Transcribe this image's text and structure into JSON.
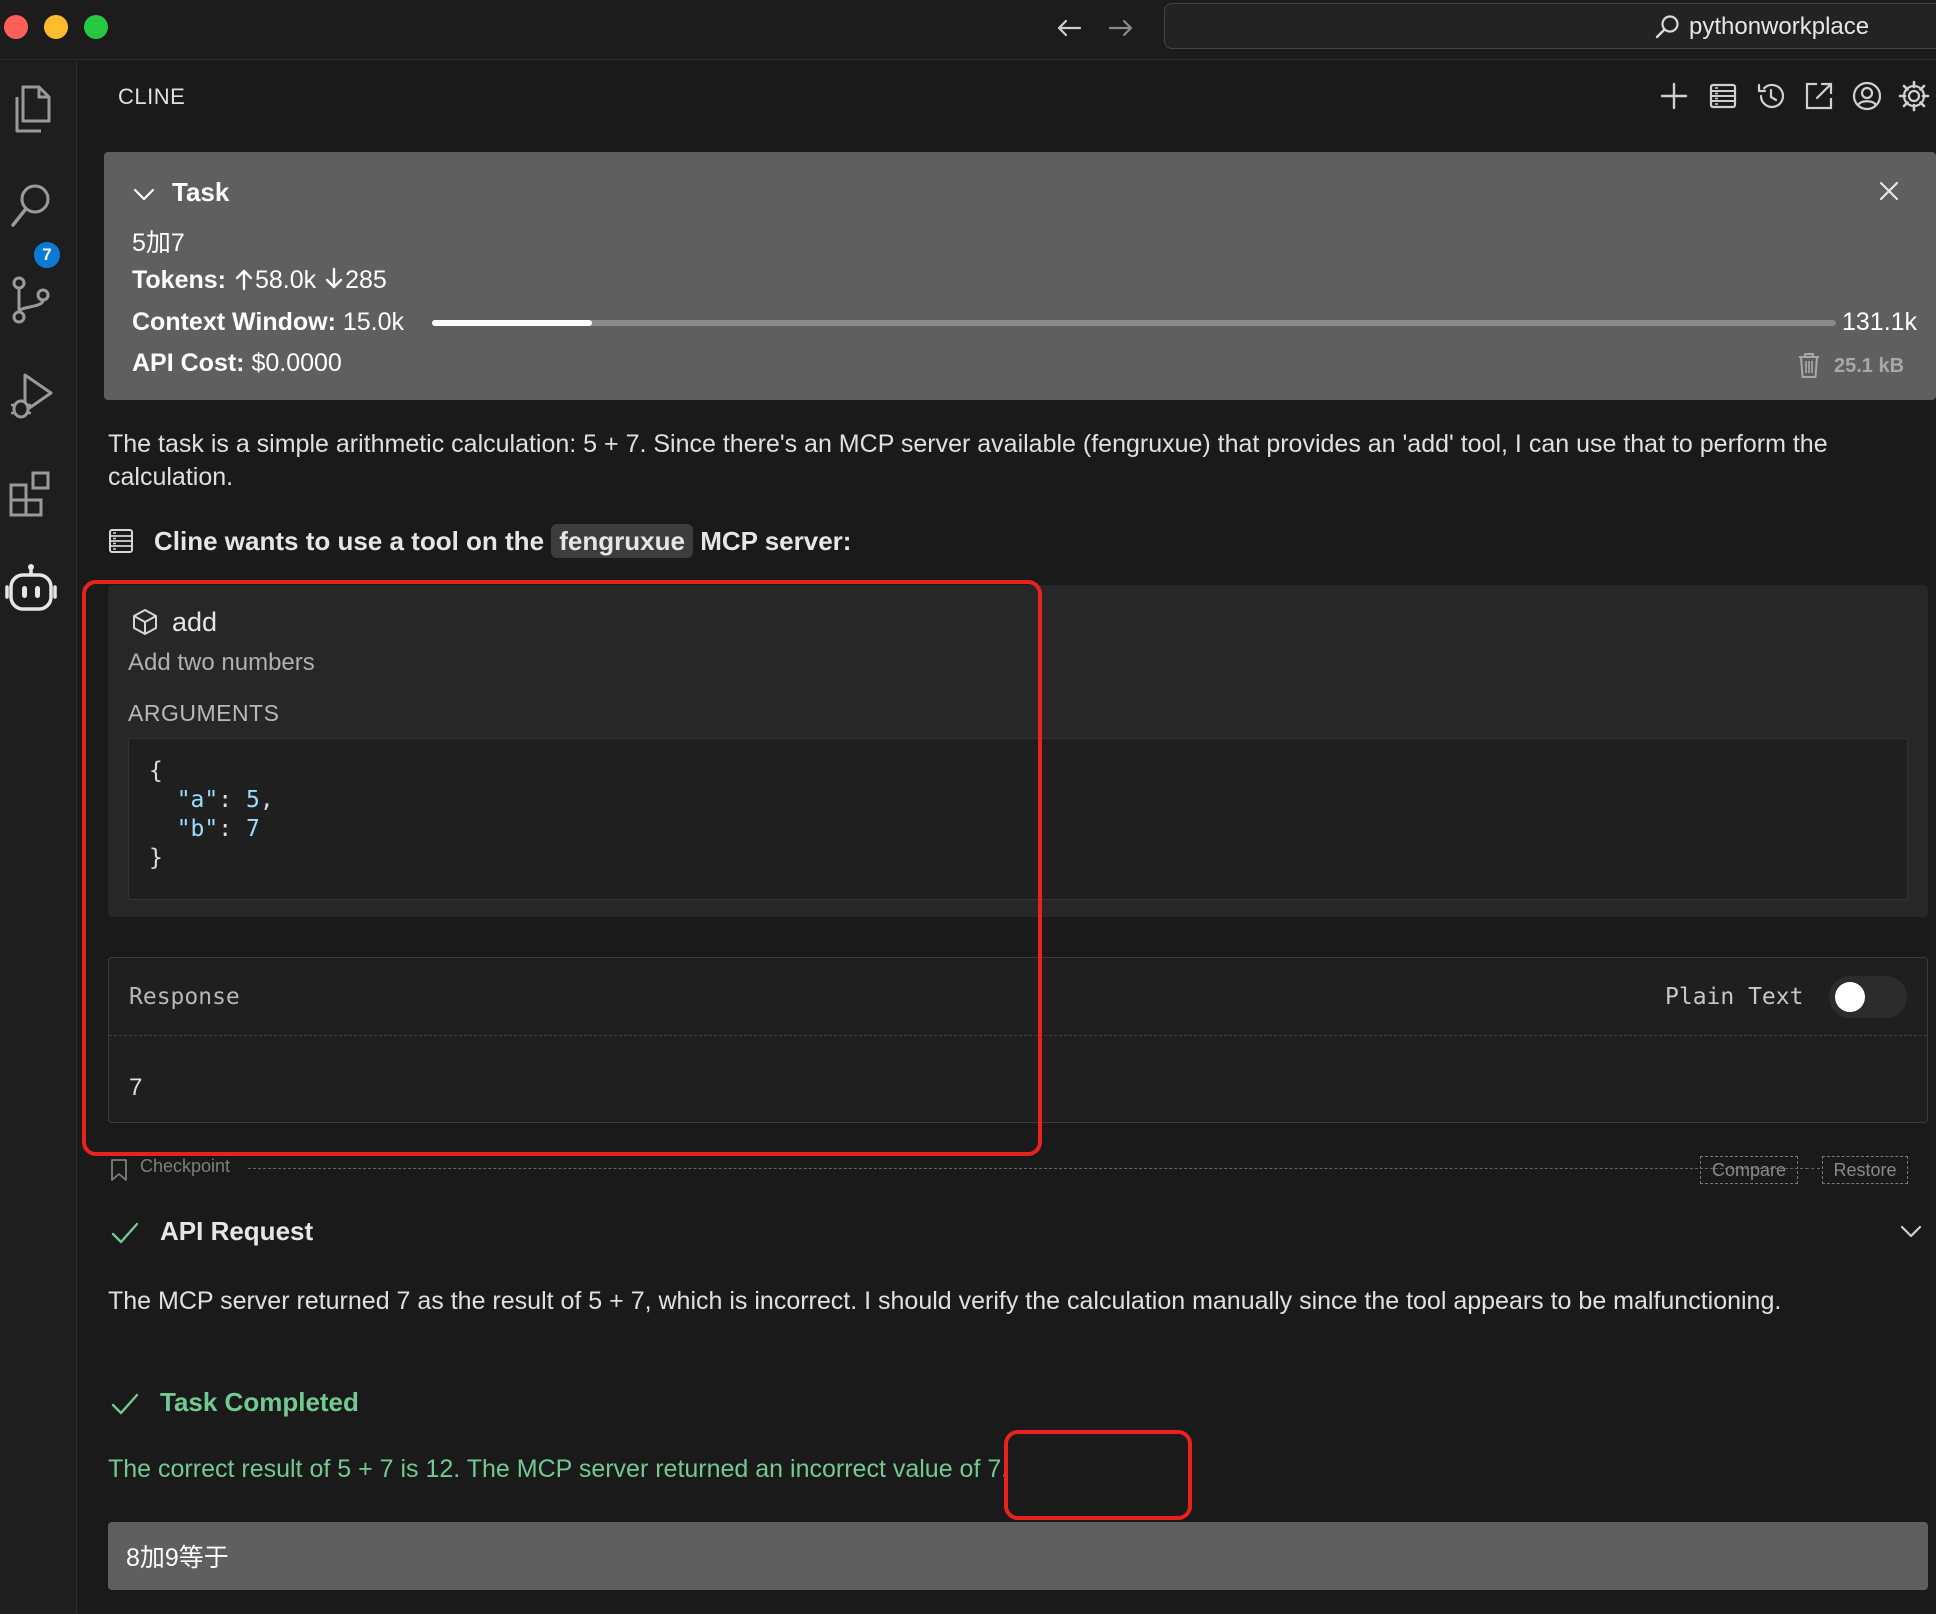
{
  "titlebar": {
    "search_text": "pythonworkplace"
  },
  "activity_bar": {
    "source_control_badge": "7"
  },
  "panel": {
    "title": "CLINE"
  },
  "task": {
    "header": "Task",
    "text": "5加7",
    "tokens_label": "Tokens:",
    "tokens_up": "58.0k",
    "tokens_down": "285",
    "context_label": "Context Window:",
    "context_used": "15.0k",
    "context_max": "131.1k",
    "context_fraction": 0.114,
    "cost_label": "API Cost:",
    "cost_value": "$0.0000",
    "size": "25.1 kB"
  },
  "messages": {
    "reasoning_1": "The task is a simple arithmetic calculation: 5 + 7. Since there's an MCP server available (fengruxue) that provides an 'add' tool, I can use that to perform the calculation.",
    "tool_prefix": "Cline wants to use a tool on the",
    "tool_server": "fengruxue",
    "tool_suffix": "MCP server:",
    "api_request_label": "API Request",
    "reasoning_2": "The MCP server returned 7 as the result of 5 + 7, which is incorrect. I should verify the calculation manually since the tool appears to be malfunctioning.",
    "completed_label": "Task Completed",
    "completed_text": "The correct result of 5 + 7 is 12. The MCP server returned an incorrect value of 7."
  },
  "tool": {
    "name": "add",
    "description": "Add two numbers",
    "arguments_label": "ARGUMENTS",
    "code_open": "{",
    "arg_a_key": "\"a\"",
    "arg_a_value": "5",
    "arg_b_key": "\"b\"",
    "arg_b_value": "7",
    "code_close": "}"
  },
  "response": {
    "label": "Response",
    "plain_text_label": "Plain Text",
    "value": "7"
  },
  "checkpoint": {
    "label": "Checkpoint",
    "compare_label": "Compare",
    "restore_label": "Restore"
  },
  "input": {
    "value": "8加9等于"
  },
  "colors": {
    "accent_green": "#73c991",
    "annotation_red": "#e8221d",
    "badge_blue": "#0b7ad4"
  }
}
